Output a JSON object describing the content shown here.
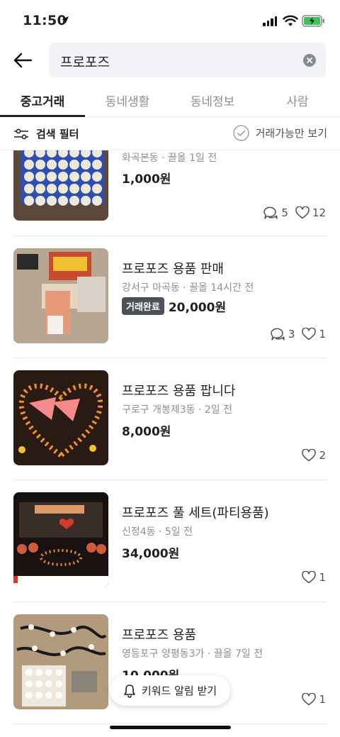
{
  "status_bar": {
    "time": "11:50"
  },
  "search": {
    "query": "프로포즈"
  },
  "tabs": [
    {
      "label": "중고거래",
      "active": true
    },
    {
      "label": "동네생활",
      "active": false
    },
    {
      "label": "동네정보",
      "active": false
    },
    {
      "label": "사람",
      "active": false
    }
  ],
  "filter": {
    "left_label": "검색 필터",
    "right_label": "거래가능만 보기"
  },
  "items": [
    {
      "title": "",
      "meta": "화곡본동 · 끌올 1일 전",
      "price": "1,000원",
      "badge": "",
      "comments": "5",
      "likes": "12"
    },
    {
      "title": "프로포즈 용품 판매",
      "meta": "강서구 마곡동 · 끌올 14시간 전",
      "price": "20,000원",
      "badge": "거래완료",
      "comments": "3",
      "likes": "1"
    },
    {
      "title": "프로포즈 용품 팝니다",
      "meta": "구로구 개봉제3동 · 2일 전",
      "price": "8,000원",
      "badge": "",
      "comments": "",
      "likes": "2"
    },
    {
      "title": "프로포즈 풀 세트(파티용품)",
      "meta": "신정4동 · 5일 전",
      "price": "34,000원",
      "badge": "",
      "comments": "",
      "likes": "1"
    },
    {
      "title": "프로포즈 용품",
      "meta": "영등포구 양평동3가 · 끌올 7일 전",
      "price": "10,000원",
      "badge": "",
      "comments": "",
      "likes": "1"
    }
  ],
  "keyword_alert": {
    "label": "키워드 알림 받기"
  },
  "colors": {
    "text": "#212124",
    "muted": "#8b8f96",
    "badge_bg": "#4d5159",
    "search_bg": "#f2f3f6"
  }
}
